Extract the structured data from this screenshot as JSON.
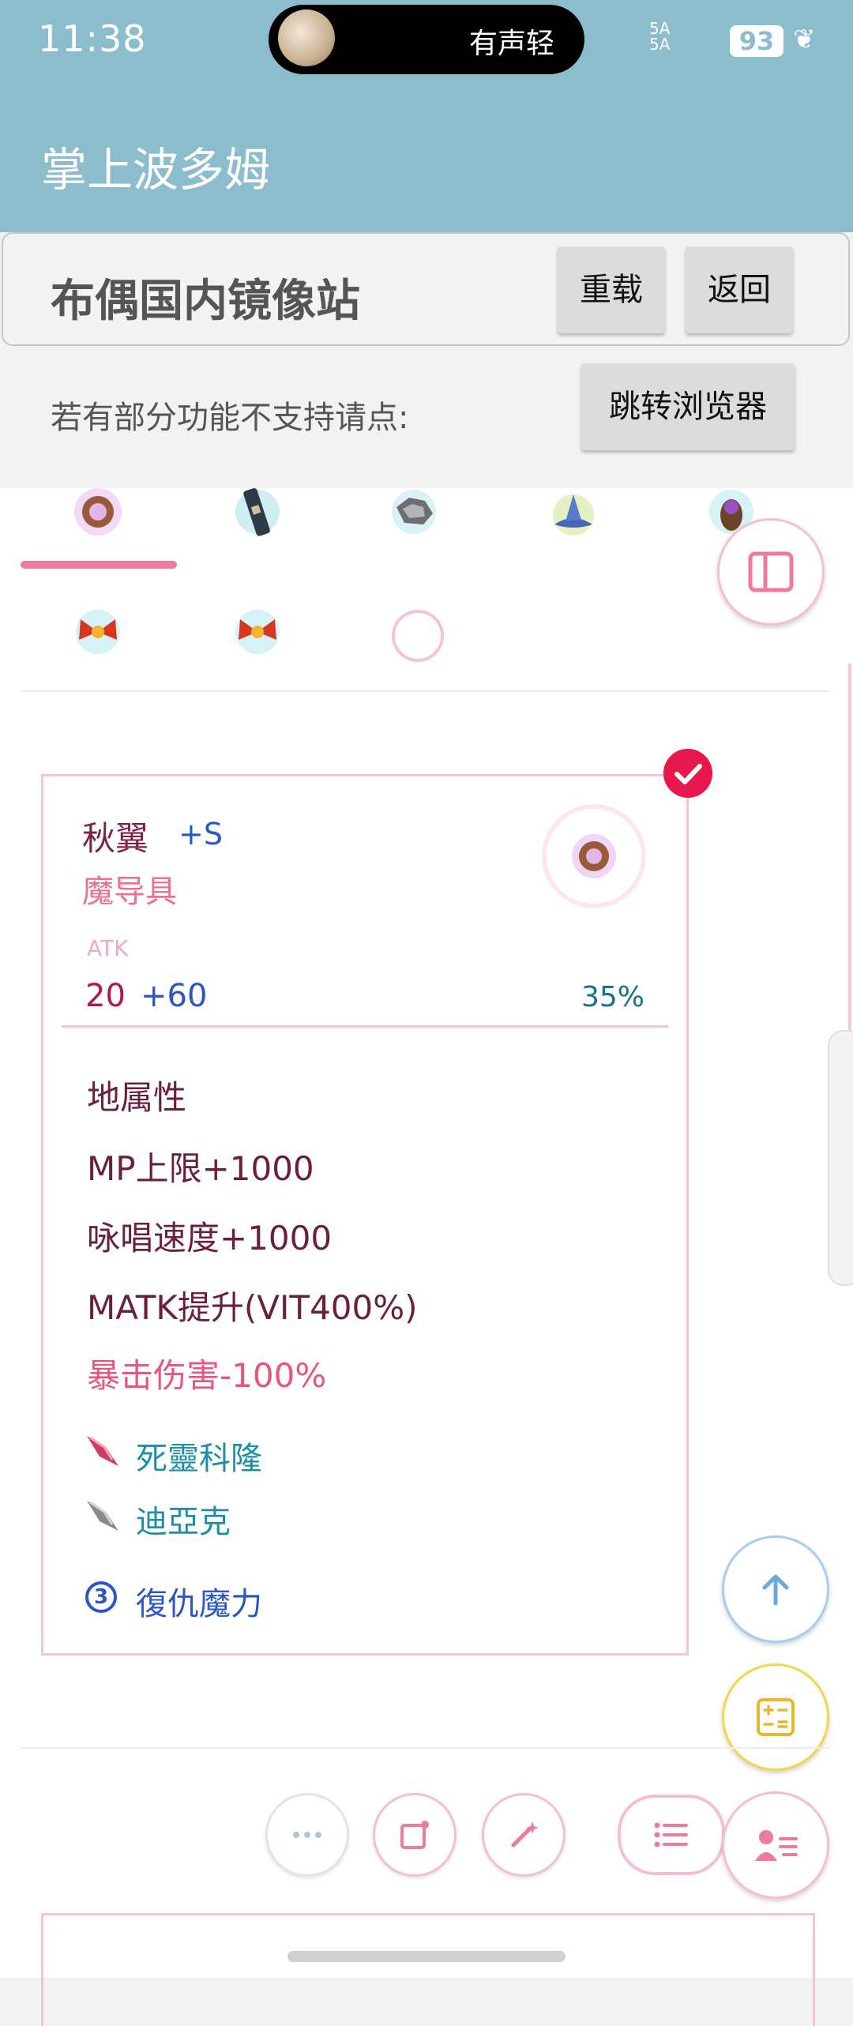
{
  "status_bar": {
    "time": "11:38",
    "island_text": "有声轻",
    "signal": "5A\n5A",
    "battery": "93"
  },
  "app": {
    "title": "掌上波多姆"
  },
  "mirror": {
    "title": "布偶国内镜像站",
    "reload_label": "重载",
    "back_label": "返回",
    "hint": "若有部分功能不支持请点:",
    "jump_label": "跳转浏览器"
  },
  "item": {
    "name": "秋翼",
    "refine": "+S",
    "type": "魔导具",
    "atk_label": "ATK",
    "atk_base": "20",
    "atk_bonus": "+60",
    "atk_pct": "35%",
    "stats": [
      "地属性",
      "MP上限+1000",
      "咏唱速度+1000",
      "MATK提升(VIT400%)"
    ],
    "negative_stat": "暴击伤害-100%",
    "cards": [
      "死靈科隆",
      "迪亞克"
    ],
    "enchant_num": "3",
    "enchant": "復仇魔力"
  },
  "colors": {
    "header": "#8bbdcd",
    "accent": "#ef7b9a",
    "check": "#e8184c",
    "blue": "#2a56c6",
    "teal": "#1b8fa8"
  }
}
